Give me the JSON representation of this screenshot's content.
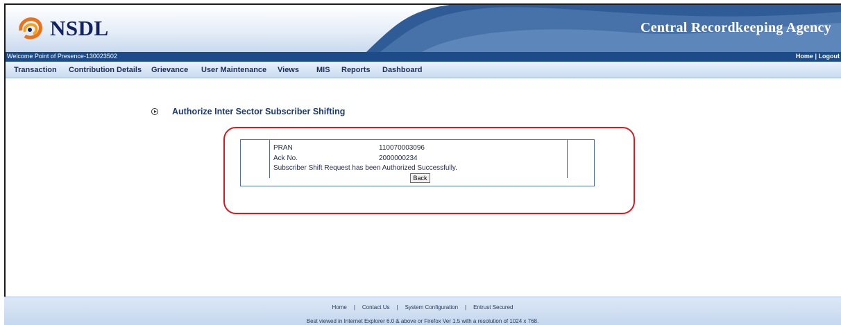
{
  "header": {
    "logo_text": "NSDL",
    "agency_name": "Central Recordkeeping Agency",
    "colors": {
      "brand_navy": "#13235f",
      "bar_blue": "#1c4b88",
      "highlight_red": "#d71920"
    }
  },
  "welcome": {
    "text": "Welcome Point of Presence-130023502",
    "home_link": "Home",
    "separator": "|",
    "logout_link": "Logout"
  },
  "menu": {
    "items": [
      "Transaction",
      "Contribution Details",
      "Grievance",
      "User Maintenance",
      "Views",
      "MIS",
      "Reports",
      "Dashboard"
    ]
  },
  "page": {
    "heading_icon": "circle-arrow-bullet-icon",
    "heading": "Authorize Inter Sector Subscriber Shifting"
  },
  "result": {
    "pran_label": "PRAN",
    "pran_value": "110070003096",
    "ack_label": "Ack No.",
    "ack_value": "2000000234",
    "message": "Subscriber Shift Request has been Authorized Successfully.",
    "back_button": "Back"
  },
  "footer": {
    "links": [
      "Home",
      "Contact Us",
      "System Configuration",
      "Entrust Secured"
    ],
    "separator": "|",
    "note": "Best viewed in Internet Explorer 6.0 & above or Firefox Ver 1.5 with a resolution of 1024 x 768."
  }
}
